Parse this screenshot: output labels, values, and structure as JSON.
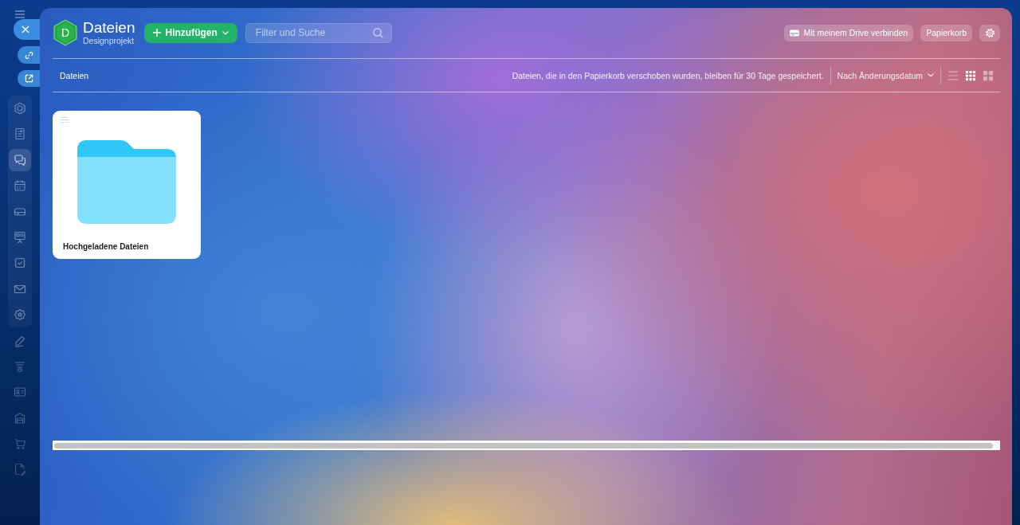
{
  "sidebar": {
    "pinned": [
      {
        "selected": false
      },
      {
        "selected": false
      },
      {
        "selected": true
      },
      {
        "selected": false
      },
      {
        "selected": false
      },
      {
        "selected": false
      },
      {
        "selected": false
      },
      {
        "selected": false
      },
      {
        "selected": false
      }
    ],
    "more": [
      {
        "selected": false
      },
      {
        "selected": false
      },
      {
        "selected": false
      },
      {
        "selected": false
      },
      {
        "selected": false
      },
      {
        "selected": false
      }
    ]
  },
  "header": {
    "logo_letter": "D",
    "title": "Dateien",
    "subtitle": "Designprojekt",
    "add_button": "Hinzufügen",
    "search": {
      "placeholder": "Filter und Suche"
    },
    "drive_button": "Mit meinem Drive verbinden",
    "trash_button": "Papierkorb"
  },
  "toolbar": {
    "breadcrumb": "Dateien",
    "notice": "Dateien, die in den Papierkorb verschoben wurden, bleiben für 30 Tage gespeichert.",
    "sort": "Nach Änderungsdatum",
    "view_modes": [
      {
        "selected": false
      },
      {
        "selected": true
      },
      {
        "selected": false
      }
    ]
  },
  "items": [
    {
      "kind": "folder",
      "name": "Hochgeladene Dateien"
    }
  ]
}
